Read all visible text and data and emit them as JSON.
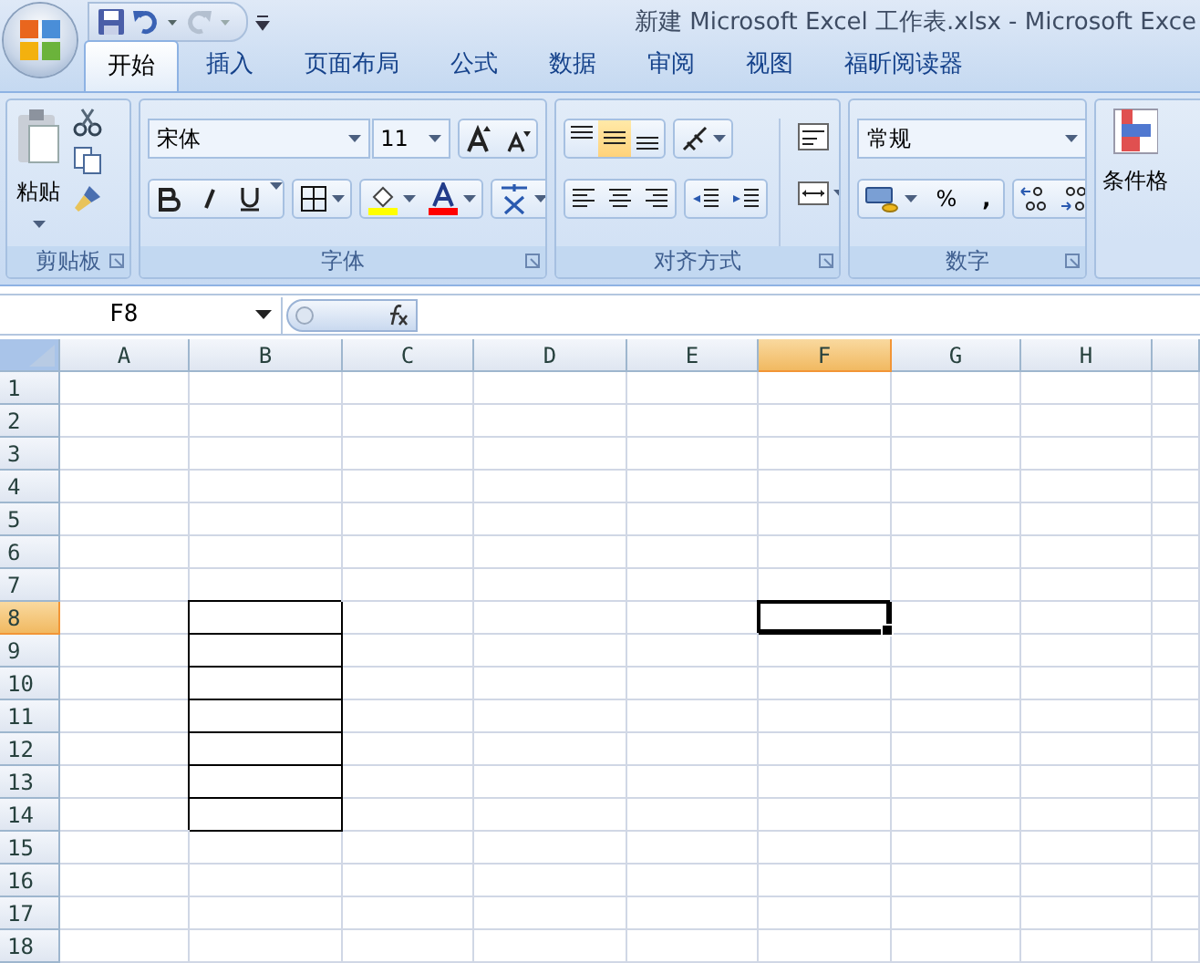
{
  "window": {
    "title": "新建 Microsoft Excel 工作表.xlsx - Microsoft Exce"
  },
  "quick_access": {
    "redo_disabled": true
  },
  "tabs": [
    {
      "label": "开始",
      "selected": true
    },
    {
      "label": "插入",
      "selected": false
    },
    {
      "label": "页面布局",
      "selected": false
    },
    {
      "label": "公式",
      "selected": false
    },
    {
      "label": "数据",
      "selected": false
    },
    {
      "label": "审阅",
      "selected": false
    },
    {
      "label": "视图",
      "selected": false
    },
    {
      "label": "福昕阅读器",
      "selected": false
    }
  ],
  "ribbon": {
    "clipboard": {
      "title": "剪贴板",
      "paste_label": "粘贴"
    },
    "font": {
      "title": "字体",
      "font_name": "宋体",
      "font_size": "11"
    },
    "alignment": {
      "title": "对齐方式",
      "vertical_buttons": [
        {
          "kind": "top",
          "selected": false
        },
        {
          "kind": "middle",
          "selected": true
        },
        {
          "kind": "bottom",
          "selected": false
        }
      ]
    },
    "number": {
      "title": "数字",
      "format": "常规",
      "percent": "%",
      "comma": ","
    },
    "styles": {
      "conditional_label": "条件格"
    }
  },
  "formula_bar": {
    "name_box": "F8"
  },
  "sheet": {
    "columns": [
      {
        "label": "A",
        "selected": false,
        "outlined": false
      },
      {
        "label": "B",
        "selected": false,
        "outlined": true
      },
      {
        "label": "C",
        "selected": false,
        "outlined": false
      },
      {
        "label": "D",
        "selected": false,
        "outlined": false
      },
      {
        "label": "E",
        "selected": false,
        "outlined": false
      },
      {
        "label": "F",
        "selected": true,
        "outlined": false
      },
      {
        "label": "G",
        "selected": false,
        "outlined": false
      },
      {
        "label": "H",
        "selected": false,
        "outlined": false
      }
    ],
    "rows": [
      {
        "label": "1",
        "selected": false,
        "outlined": false
      },
      {
        "label": "2",
        "selected": false,
        "outlined": false
      },
      {
        "label": "3",
        "selected": false,
        "outlined": false
      },
      {
        "label": "4",
        "selected": false,
        "outlined": false
      },
      {
        "label": "5",
        "selected": false,
        "outlined": false
      },
      {
        "label": "6",
        "selected": false,
        "outlined": false
      },
      {
        "label": "7",
        "selected": false,
        "outlined": false
      },
      {
        "label": "8",
        "selected": true,
        "outlined": true
      },
      {
        "label": "9",
        "selected": false,
        "outlined": true
      },
      {
        "label": "10",
        "selected": false,
        "outlined": true
      },
      {
        "label": "11",
        "selected": false,
        "outlined": true
      },
      {
        "label": "12",
        "selected": false,
        "outlined": true
      },
      {
        "label": "13",
        "selected": false,
        "outlined": true
      },
      {
        "label": "14",
        "selected": false,
        "outlined": true
      },
      {
        "label": "15",
        "selected": false,
        "outlined": false
      },
      {
        "label": "16",
        "selected": false,
        "outlined": false
      },
      {
        "label": "17",
        "selected": false,
        "outlined": false
      },
      {
        "label": "18",
        "selected": false,
        "outlined": false
      }
    ]
  }
}
